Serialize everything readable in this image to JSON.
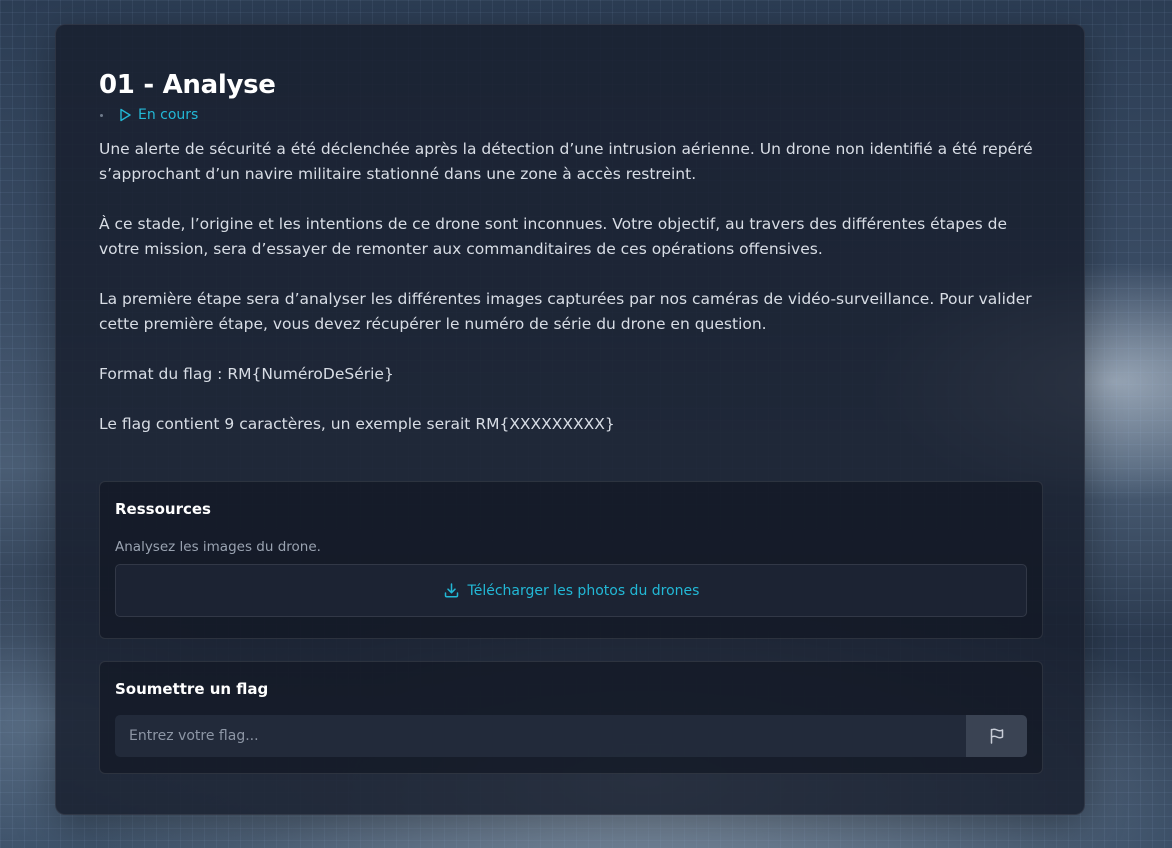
{
  "challenge": {
    "title": "01 - Analyse",
    "status": "En cours",
    "description": [
      "Une alerte de sécurité a été déclenchée après la détection d’une intrusion aérienne. Un drone non identifié a été repéré s’approchant d’un navire militaire stationné dans une zone à accès restreint.",
      "À ce stade, l’origine et les intentions de ce drone sont inconnues. Votre objectif, au travers des différentes étapes de votre mission, sera d’essayer de remonter aux commanditaires de ces opérations offensives.",
      "La première étape sera d’analyser les différentes images capturées par nos caméras de vidéo-surveillance. Pour valider cette première étape, vous devez récupérer le numéro de série du drone en question.",
      "Format du flag : RM{NuméroDeSérie}",
      "Le flag contient 9 caractères, un exemple serait RM{XXXXXXXXX}"
    ]
  },
  "resources": {
    "title": "Ressources",
    "subtitle": "Analysez les images du drone.",
    "download_label": "Télécharger les photos du drones",
    "download_icon": "download-icon"
  },
  "flag_submit": {
    "title": "Soumettre un flag",
    "placeholder": "Entrez votre flag...",
    "value": "",
    "submit_icon": "flag-icon"
  },
  "colors": {
    "accent": "#22b8d6",
    "panel_bg": "#18202e",
    "text": "#d8dde5"
  }
}
